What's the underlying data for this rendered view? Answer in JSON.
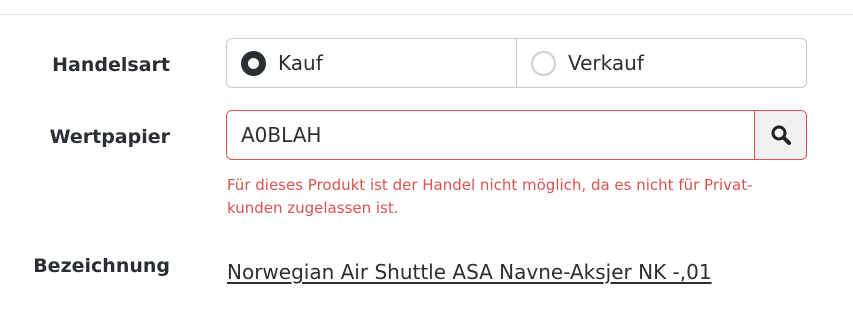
{
  "form": {
    "trade_type": {
      "label": "Handelsart",
      "options": [
        {
          "label": "Kauf",
          "selected": true
        },
        {
          "label": "Verkauf",
          "selected": false
        }
      ]
    },
    "security": {
      "label": "Wertpapier",
      "value": "A0BLAH",
      "search_icon": "search-icon",
      "error": "Für dieses Produkt ist der Handel nicht möglich, da es nicht für Privat-kunden zugelassen ist.",
      "error_line1": "Für dieses Produkt ist der Handel nicht möglich, da es nicht für Privat-",
      "error_line2": "kunden zugelassen ist."
    },
    "name": {
      "label": "Bezeichnung",
      "value": "Norwegian Air Shuttle ASA Navne-Aksjer NK -,01"
    }
  },
  "colors": {
    "error": "#d9534f",
    "text": "#2b2f33",
    "border": "#c9c9c9"
  }
}
